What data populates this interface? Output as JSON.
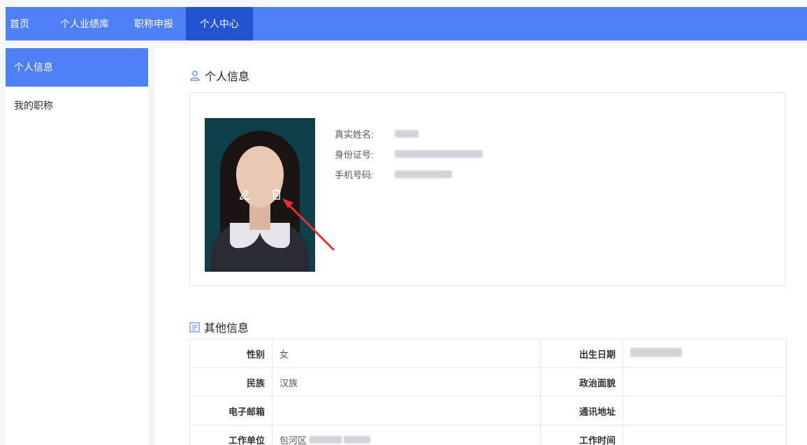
{
  "nav": {
    "items": [
      "首页",
      "个人业绩库",
      "职称申报",
      "个人中心"
    ],
    "active_index": 3,
    "accent": "#4e7ff5",
    "active_bg": "#2254cf"
  },
  "sidebar": {
    "items": [
      "个人信息",
      "我的职称"
    ],
    "active_index": 0
  },
  "profile": {
    "section_title": "个人信息",
    "section_icon": "user-icon",
    "photo_actions": [
      "edit-icon",
      "delete-icon"
    ],
    "fields": [
      {
        "label": "真实姓名:"
      },
      {
        "label": "身份证号:"
      },
      {
        "label": "手机号码:"
      }
    ]
  },
  "other": {
    "section_title": "其他信息",
    "section_icon": "document-icon",
    "rows": [
      {
        "l1": "性别",
        "v1": "女",
        "l2": "出生日期",
        "v2": ""
      },
      {
        "l1": "民族",
        "v1": "汉族",
        "l2": "政治面貌",
        "v2": ""
      },
      {
        "l1": "电子邮箱",
        "v1": "",
        "l2": "通讯地址",
        "v2": ""
      },
      {
        "l1": "工作单位",
        "v1": "包河区",
        "l2": "工作时间",
        "v2": ""
      }
    ]
  },
  "annotation_color": "#e8302a"
}
